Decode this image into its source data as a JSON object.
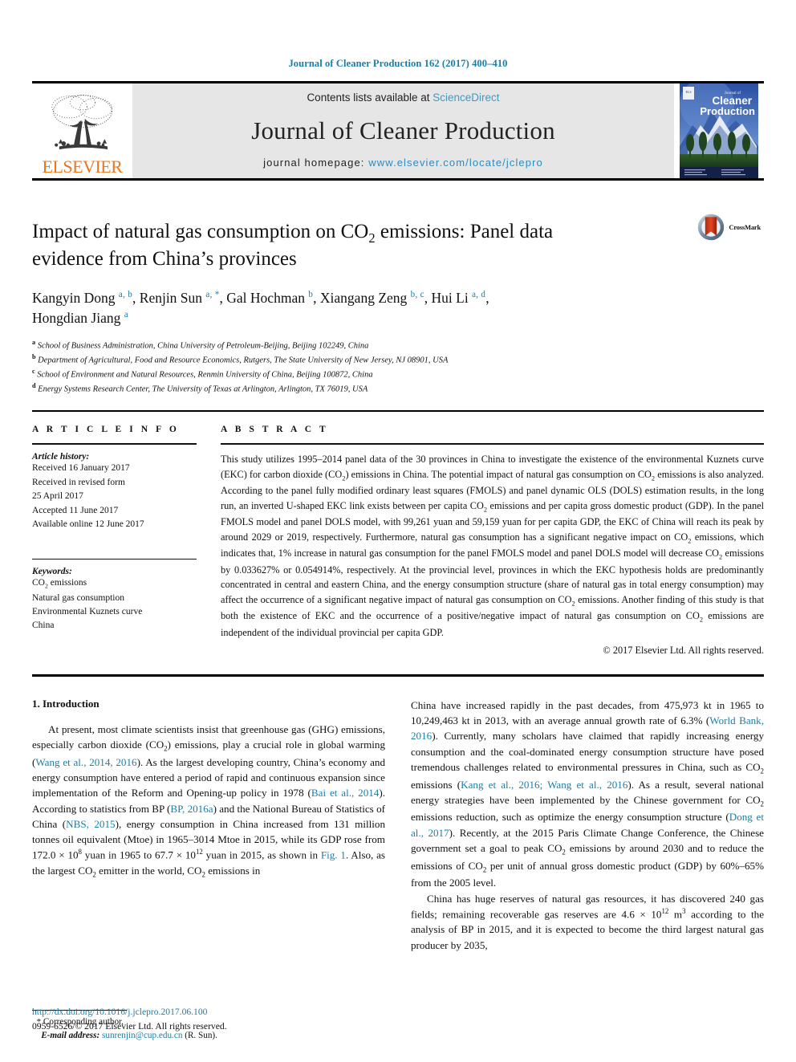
{
  "running_head": "Journal of Cleaner Production 162 (2017) 400–410",
  "masthead": {
    "contents_prefix": "Contents lists available at ",
    "sciencedirect": "ScienceDirect",
    "journal_title": "Journal of Cleaner Production",
    "homepage_prefix": "journal homepage: ",
    "homepage_url": "www.elsevier.com/locate/jclepro",
    "publisher": "ELSEVIER",
    "cover_title_small": "Journal of",
    "cover_title_line1": "Cleaner",
    "cover_title_line2": "Production",
    "link_color": "#2E8BC0",
    "accent_color": "#E87722"
  },
  "article": {
    "title_line1_a": "Impact of natural gas consumption on CO",
    "title_line1_sub": "2",
    "title_line1_b": " emissions: Panel data",
    "title_line2": "evidence from China’s provinces",
    "crossmark_label": "CrossMark",
    "authors": [
      {
        "name": "Kangyin Dong",
        "sup": "a, b",
        "sep": ", "
      },
      {
        "name": "Renjin Sun",
        "sup": "a, *",
        "sep": ", "
      },
      {
        "name": "Gal Hochman",
        "sup": "b",
        "sep": ", "
      },
      {
        "name": "Xiangang Zeng",
        "sup": "b, c",
        "sep": ", "
      },
      {
        "name": "Hui Li",
        "sup": "a, d",
        "sep": ", "
      },
      {
        "name": "Hongdian Jiang",
        "sup": "a",
        "sep": ""
      }
    ],
    "affiliations": [
      {
        "mark": "a",
        "text": "School of Business Administration, China University of Petroleum-Beijing, Beijing 102249, China"
      },
      {
        "mark": "b",
        "text": "Department of Agricultural, Food and Resource Economics, Rutgers, The State University of New Jersey, NJ 08901, USA"
      },
      {
        "mark": "c",
        "text": "School of Environment and Natural Resources, Renmin University of China, Beijing 100872, China"
      },
      {
        "mark": "d",
        "text": "Energy Systems Research Center, The University of Texas at Arlington, Arlington, TX 76019, USA"
      }
    ]
  },
  "article_info": {
    "heading": "A R T I C L E   I N F O",
    "history_label": "Article history:",
    "history": [
      "Received 16 January 2017",
      "Received in revised form",
      "25 April 2017",
      "Accepted 11 June 2017",
      "Available online 12 June 2017"
    ],
    "keywords_label": "Keywords:",
    "keywords": [
      "CO2 emissions",
      "Natural gas consumption",
      "Environmental Kuznets curve",
      "China"
    ],
    "keyword_co2_a": "CO",
    "keyword_co2_sub": "2",
    "keyword_co2_b": " emissions"
  },
  "abstract": {
    "heading": "A B S T R A C T",
    "paragraph": "This study utilizes 1995–2014 panel data of the 30 provinces in China to investigate the existence of the environmental Kuznets curve (EKC) for carbon dioxide (CO2) emissions in China. The potential impact of natural gas consumption on CO2 emissions is also analyzed. According to the panel fully modified ordinary least squares (FMOLS) and panel dynamic OLS (DOLS) estimation results, in the long run, an inverted U-shaped EKC link exists between per capita CO2 emissions and per capita gross domestic product (GDP). In the panel FMOLS model and panel DOLS model, with 99,261 yuan and 59,159 yuan for per capita GDP, the EKC of China will reach its peak by around 2029 or 2019, respectively. Furthermore, natural gas consumption has a significant negative impact on CO2 emissions, which indicates that, 1% increase in natural gas consumption for the panel FMOLS model and panel DOLS model will decrease CO2 emissions by 0.033627% or 0.054914%, respectively. At the provincial level, provinces in which the EKC hypothesis holds are predominantly concentrated in central and eastern China, and the energy consumption structure (share of natural gas in total energy consumption) may affect the occurrence of a significant negative impact of natural gas consumption on CO2 emissions. Another finding of this study is that both the existence of EKC and the occurrence of a positive/negative impact of natural gas consumption on CO2 emissions are independent of the individual provincial per capita GDP.",
    "copyright": "© 2017 Elsevier Ltd. All rights reserved."
  },
  "introduction": {
    "heading": "1. Introduction",
    "left_paragraph": "At present, most climate scientists insist that greenhouse gas (GHG) emissions, especially carbon dioxide (CO2) emissions, play a crucial role in global warming (Wang et al., 2014, 2016). As the largest developing country, China’s economy and energy consumption have entered a period of rapid and continuous expansion since implementation of the Reform and Opening-up policy in 1978 (Bai et al., 2014). According to statistics from BP (BP, 2016a) and the National Bureau of Statistics of China (NBS, 2015), energy consumption in China increased from 131 million tonnes oil equivalent (Mtoe) in 1965–3014 Mtoe in 2015, while its GDP rose from 172.0 × 108 yuan in 1965 to 67.7 × 1012 yuan in 2015, as shown in Fig. 1. Also, as the largest CO2 emitter in the world, CO2 emissions in",
    "right_paragraph_1": "China have increased rapidly in the past decades, from 475,973 kt in 1965 to 10,249,463 kt in 2013, with an average annual growth rate of 6.3% (World Bank, 2016). Currently, many scholars have claimed that rapidly increasing energy consumption and the coal-dominated energy consumption structure have posed tremendous challenges related to environmental pressures in China, such as CO2 emissions (Kang et al., 2016; Wang et al., 2016). As a result, several national energy strategies have been implemented by the Chinese government for CO2 emissions reduction, such as optimize the energy consumption structure (Dong et al., 2017). Recently, at the 2015 Paris Climate Change Conference, the Chinese government set a goal to peak CO2 emissions by around 2030 and to reduce the emissions of CO2 per unit of annual gross domestic product (GDP) by 60%–65% from the 2005 level.",
    "right_paragraph_2": "China has huge reserves of natural gas resources, it has discovered 240 gas fields; remaining recoverable gas reserves are 4.6 × 1012 m3 according to the analysis of BP in 2015, and it is expected to become the third largest natural gas producer by 2035,",
    "citations": [
      "Wang et al., 2014, 2016",
      "Bai et al., 2014",
      "BP, 2016a",
      "NBS, 2015",
      "Fig. 1",
      "World Bank, 2016",
      "Kang et al., 2016; Wang et al., 2016",
      "Dong et al., 2017"
    ]
  },
  "footnote": {
    "star": "*",
    "corresponding": "Corresponding author.",
    "email_label": "E-mail address:",
    "email": "sunrenjin@cup.edu.cn",
    "email_owner": "(R. Sun)."
  },
  "page_footer": {
    "doi": "http://dx.doi.org/10.1016/j.jclepro.2017.06.100",
    "issn_line": "0959-6526/© 2017 Elsevier Ltd. All rights reserved."
  }
}
